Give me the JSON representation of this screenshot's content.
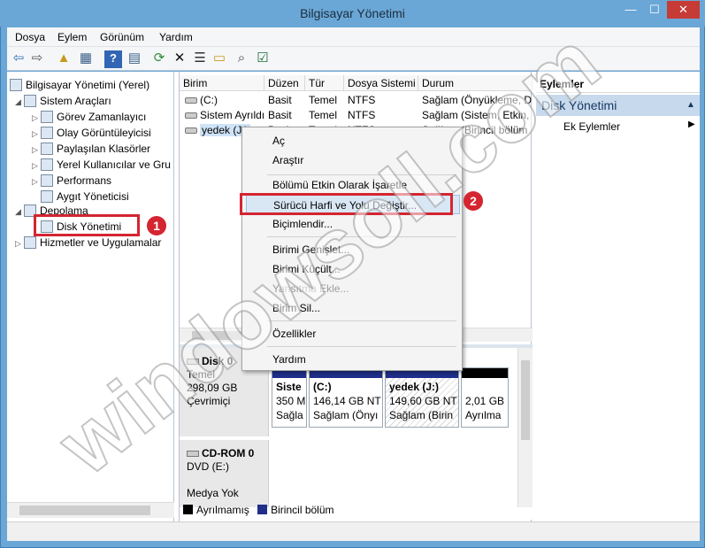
{
  "window": {
    "title": "Bilgisayar Yönetimi",
    "minimize": "—",
    "maximize": "☐",
    "close": "✕"
  },
  "menu": [
    "Dosya",
    "Eylem",
    "Görünüm",
    "Yardım"
  ],
  "toolbar": [
    "back-icon",
    "forward-icon",
    "up-icon",
    "show-hide-tree-icon",
    "help-icon",
    "console-icon",
    "refresh-icon",
    "delete-icon",
    "properties-icon",
    "open-icon",
    "search-icon",
    "checklist-icon"
  ],
  "tree": {
    "root": "Bilgisayar Yönetimi (Yerel)",
    "items": [
      {
        "label": "Sistem Araçları",
        "arrow": "◢"
      },
      {
        "label": "Görev Zamanlayıcı",
        "arrow": "▷"
      },
      {
        "label": "Olay Görüntüleyicisi",
        "arrow": "▷"
      },
      {
        "label": "Paylaşılan Klasörler",
        "arrow": "▷"
      },
      {
        "label": "Yerel Kullanıcılar ve Gru",
        "arrow": "▷"
      },
      {
        "label": "Performans",
        "arrow": "▷"
      },
      {
        "label": "Aygıt Yöneticisi",
        "arrow": ""
      },
      {
        "label": "Depolama",
        "arrow": "◢"
      },
      {
        "label": "Disk Yönetimi",
        "arrow": ""
      },
      {
        "label": "Hizmetler ve Uygulamalar",
        "arrow": "▷"
      }
    ]
  },
  "volume_table": {
    "headers": [
      "Birim",
      "Düzen",
      "Tür",
      "Dosya Sistemi",
      "Durum"
    ],
    "rows": [
      [
        "(C:)",
        "Basit",
        "Temel",
        "NTFS",
        "Sağlam (Önyükleme, D"
      ],
      [
        "Sistem Ayrıldı",
        "Basit",
        "Temel",
        "NTFS",
        "Sağlam (Sistem, Etkin,"
      ],
      [
        "yedek (J:)",
        "Basit",
        "Temel",
        "NTFS",
        "Sağlam (Birincil bölüm"
      ]
    ]
  },
  "context_menu": {
    "items": [
      {
        "label": "Aç",
        "disabled": false
      },
      {
        "label": "Araştır",
        "disabled": false
      },
      {
        "label": "Bölümü Etkin Olarak İşaretle",
        "disabled": false
      },
      {
        "label": "Sürücü Harfi ve Yolu Değiştir...",
        "disabled": false
      },
      {
        "label": "Biçimlendir...",
        "disabled": false
      },
      {
        "label": "Birimi Genişlet...",
        "disabled": false
      },
      {
        "label": "Birimi Küçült...",
        "disabled": false
      },
      {
        "label": "Yansıtma Ekle...",
        "disabled": true
      },
      {
        "label": "Birim Sil...",
        "disabled": false
      },
      {
        "label": "Özellikler",
        "disabled": false
      },
      {
        "label": "Yardım",
        "disabled": false
      }
    ]
  },
  "disks": [
    {
      "name": "Disk 0",
      "type": "Temel",
      "size": "298,09 GB",
      "state": "Çevrimiçi"
    },
    {
      "name": "CD-ROM 0",
      "type": "DVD (E:)",
      "size": "",
      "state": "Medya Yok"
    }
  ],
  "partitions": [
    {
      "title": "Siste",
      "size": "350 M",
      "status": "Sağla"
    },
    {
      "title": "(C:)",
      "size": "146,14 GB NT",
      "status": "Sağlam (Önyı"
    },
    {
      "title": "yedek (J:)",
      "size": "149,60 GB NT",
      "status": "Sağlam (Birin"
    },
    {
      "title": "",
      "size": "2,01 GB",
      "status": "Ayrılma"
    }
  ],
  "legend": [
    "Ayrılmamış",
    "Birincil bölüm"
  ],
  "actions": {
    "header": "Eylemler",
    "section": "Disk Yönetimi",
    "item": "Ek Eylemler"
  },
  "markers": [
    "1",
    "2"
  ],
  "watermark": "windowsoll.com",
  "colors": {
    "accent": "#6aa7d6",
    "marker": "#d42531",
    "primary_partition": "#1f2f8a",
    "unallocated": "#000000"
  }
}
